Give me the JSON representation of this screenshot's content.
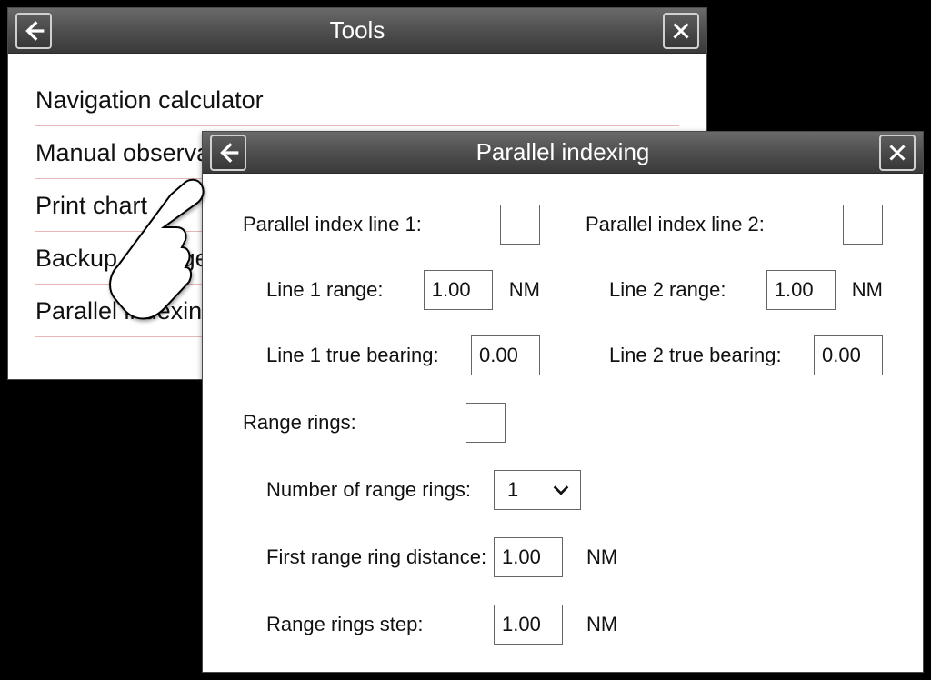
{
  "tools_panel": {
    "title": "Tools",
    "items": [
      "Navigation calculator",
      "Manual observation",
      "Print chart",
      "Backup arrangement",
      "Parallel indexing"
    ]
  },
  "pi_panel": {
    "title": "Parallel indexing",
    "line1": {
      "label": "Parallel index line 1:",
      "range_label": "Line 1 range:",
      "range_value": "1.00",
      "range_unit": "NM",
      "bearing_label": "Line 1 true bearing:",
      "bearing_value": "0.00"
    },
    "line2": {
      "label": "Parallel index line 2:",
      "range_label": "Line 2 range:",
      "range_value": "1.00",
      "range_unit": "NM",
      "bearing_label": "Line 2 true bearing:",
      "bearing_value": "0.00"
    },
    "rings": {
      "label": "Range rings:",
      "count_label": "Number of range rings:",
      "count_value": "1",
      "first_label": "First range ring distance:",
      "first_value": "1.00",
      "first_unit": "NM",
      "step_label": "Range rings step:",
      "step_value": "1.00",
      "step_unit": "NM"
    }
  }
}
